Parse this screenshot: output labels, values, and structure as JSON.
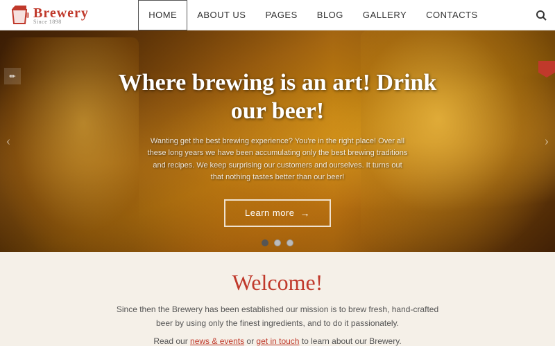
{
  "header": {
    "logo_text": "Brewery",
    "logo_sub": "Since 1898",
    "nav": [
      {
        "label": "HOME",
        "active": true
      },
      {
        "label": "ABOUT US",
        "active": false
      },
      {
        "label": "PAGES",
        "active": false
      },
      {
        "label": "BLOG",
        "active": false
      },
      {
        "label": "GALLERY",
        "active": false
      },
      {
        "label": "CONTACTS",
        "active": false
      }
    ],
    "search_label": "🔍"
  },
  "hero": {
    "title": "Where brewing is an art! Drink our beer!",
    "subtitle": "Wanting get the best brewing experience? You're in the right place! Over all these long years we have been accumulating only the best brewing traditions and recipes. We keep surprising our customers and ourselves. It turns out that nothing tastes better than our beer!",
    "btn_label": "Learn more",
    "dots": [
      "active",
      "inactive",
      "inactive"
    ]
  },
  "welcome": {
    "title": "Welcome!",
    "text_line1": "Since then the Brewery has been established our mission is to brew fresh, hand-crafted",
    "text_line2": "beer by using only the finest ingredients, and to do it passionately.",
    "link_prefix": "Read our ",
    "link1": "news & events",
    "link_mid": " or ",
    "link2": "get in touch",
    "link_suffix": " to learn about our Brewery."
  },
  "colors": {
    "accent": "#c0392b",
    "text_dark": "#333",
    "text_muted": "#555",
    "background": "#f5f0e8"
  }
}
